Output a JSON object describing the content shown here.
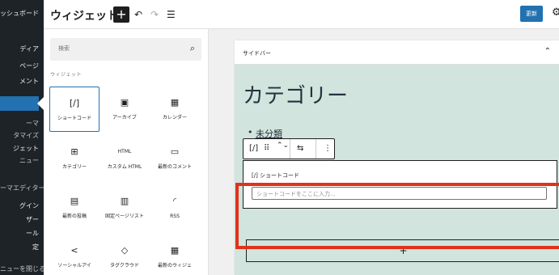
{
  "wp_sidebar": {
    "items": [
      "ッシュボード",
      "ディア",
      "ページ",
      "メント",
      "ーマ",
      "タマイズ",
      "ジェット",
      "ニュー",
      "ーマエディター",
      "グイン",
      "ザー",
      "ール",
      "定",
      "ニューを閉じる"
    ]
  },
  "header": {
    "title": "ウィジェット",
    "add_symbol": "+",
    "undo_icon": "↶",
    "redo_icon": "↷",
    "list_view_icon": "☰",
    "update_label": "更新",
    "gear_icon": "⚙"
  },
  "inserter": {
    "search_placeholder": "検索",
    "search_icon": "⌕",
    "section_label": "ウィジェット",
    "blocks": [
      {
        "icon": "[/]",
        "label": "ショートコード",
        "selected": true
      },
      {
        "icon": "▣",
        "label": "アーカイブ"
      },
      {
        "icon": "▦",
        "label": "カレンダー"
      },
      {
        "icon": "⊞",
        "label": "カテゴリー"
      },
      {
        "icon": "HTML",
        "label": "カスタム HTML"
      },
      {
        "icon": "▭",
        "label": "最新のコメント"
      },
      {
        "icon": "▤",
        "label": "最新の投稿"
      },
      {
        "icon": "▥",
        "label": "固定ページリスト"
      },
      {
        "icon": "◜",
        "label": "RSS"
      },
      {
        "icon": "<",
        "label": "ソーシャルアイ"
      },
      {
        "icon": "◇",
        "label": "タグクラウド"
      },
      {
        "icon": "▦",
        "label": "最新のウィジェ"
      }
    ]
  },
  "editor": {
    "area_title": "サイドバー",
    "collapse_icon": "⌃",
    "heading": "カテゴリー",
    "category_item": "未分類",
    "toolbar_icons": [
      "[/]",
      "⠿",
      "⌃⌄",
      "⇆",
      "⋮"
    ],
    "shortcode_header": "[/] ショートコード",
    "shortcode_placeholder": "ショートコードをここに入力...",
    "appender_symbol": "+"
  }
}
